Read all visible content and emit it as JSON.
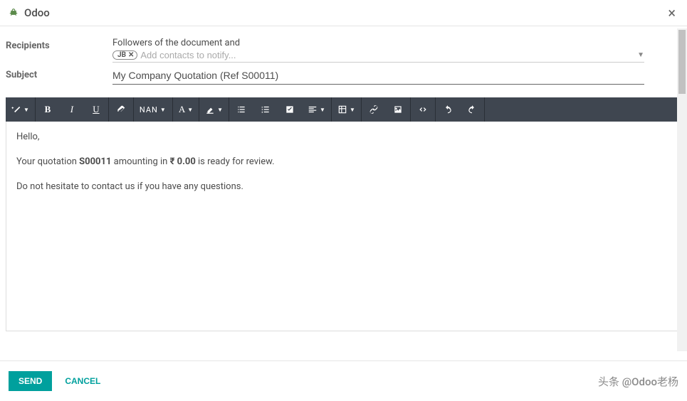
{
  "dialog": {
    "title": "Odoo",
    "close": "×"
  },
  "form": {
    "recipients_label": "Recipients",
    "followers_text": "Followers of the document and",
    "tag": {
      "label": "JB",
      "remove": "✕"
    },
    "contacts_placeholder": "Add contacts to notify...",
    "subject_label": "Subject",
    "subject_value": "My Company Quotation (Ref S00011)"
  },
  "toolbar": {
    "nan": "NAN",
    "font_letter": "A"
  },
  "body": {
    "greeting": "Hello,",
    "line2_a": "Your quotation ",
    "line2_quot": "S00011",
    "line2_b": " amounting in ",
    "line2_amount": "₹ 0.00",
    "line2_c": " is ready for review.",
    "line3": "Do not hesitate to contact us if you have any questions."
  },
  "footer": {
    "send": "SEND",
    "cancel": "CANCEL",
    "watermark": "头条 @Odoo老杨"
  }
}
